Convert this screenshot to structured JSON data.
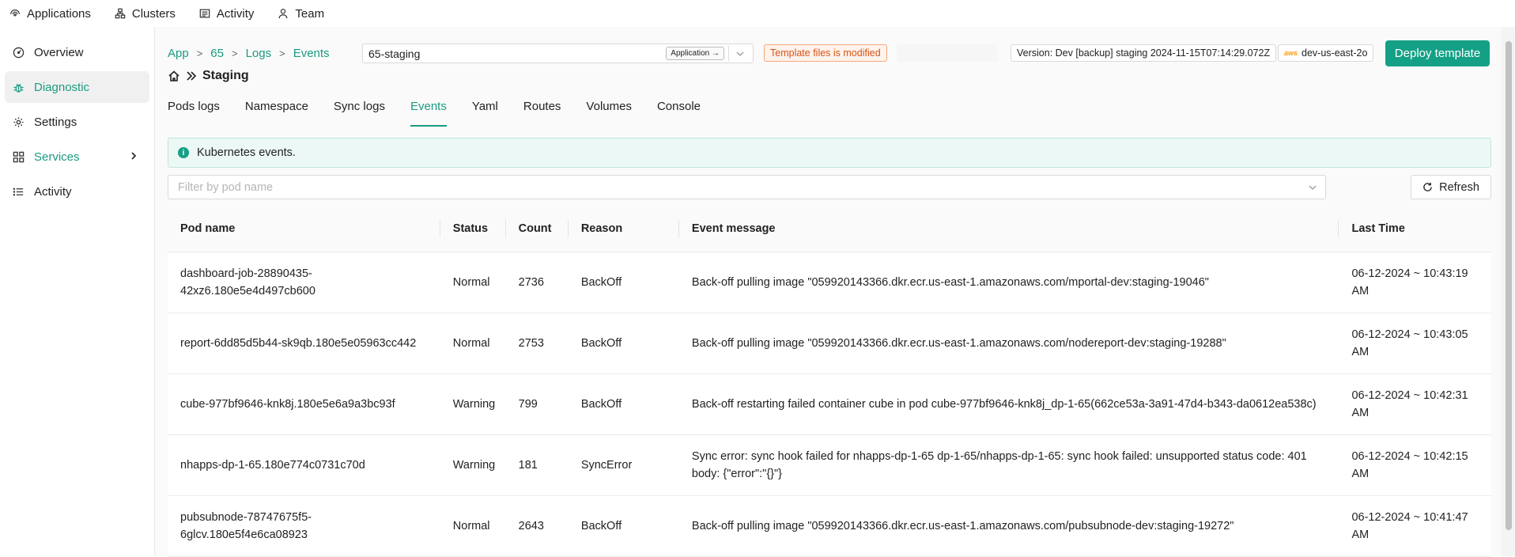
{
  "topnav": [
    {
      "label": "Applications",
      "icon": "applications-icon"
    },
    {
      "label": "Clusters",
      "icon": "clusters-icon"
    },
    {
      "label": "Activity",
      "icon": "activity-icon"
    },
    {
      "label": "Team",
      "icon": "team-icon"
    }
  ],
  "sidebar": {
    "items": [
      {
        "label": "Overview",
        "icon": "dashboard-icon"
      },
      {
        "label": "Diagnostic",
        "icon": "bug-icon"
      },
      {
        "label": "Settings",
        "icon": "gear-icon"
      },
      {
        "label": "Services",
        "icon": "services-icon"
      },
      {
        "label": "Activity",
        "icon": "list-icon"
      }
    ]
  },
  "breadcrumb": [
    "App",
    "65",
    "Logs",
    "Events"
  ],
  "environment": {
    "value": "65-staging",
    "app_button": "Application →"
  },
  "status_badge": "Template files is modified",
  "version": "Version: Dev [backup] staging 2024-11-15T07:14:29.072Z",
  "cluster": {
    "provider": "aws",
    "name": "dev-us-east-2o"
  },
  "deploy_button": "Deploy template",
  "page_title": "Staging",
  "tabs": [
    "Pods logs",
    "Namespace",
    "Sync logs",
    "Events",
    "Yaml",
    "Routes",
    "Volumes",
    "Console"
  ],
  "active_tab": "Events",
  "info_text": "Kubernetes events.",
  "filter": {
    "placeholder": "Filter by pod name"
  },
  "refresh_button": "Refresh",
  "table": {
    "columns": [
      "Pod name",
      "Status",
      "Count",
      "Reason",
      "Event message",
      "Last Time"
    ],
    "rows": [
      {
        "pod": "dashboard-job-28890435-42xz6.180e5e4d497cb600",
        "status": "Normal",
        "count": "2736",
        "reason": "BackOff",
        "message": "Back-off pulling image \"059920143366.dkr.ecr.us-east-1.amazonaws.com/mportal-dev:staging-19046\"",
        "time": "06-12-2024 ~ 10:43:19 AM"
      },
      {
        "pod": "report-6dd85d5b44-sk9qb.180e5e05963cc442",
        "status": "Normal",
        "count": "2753",
        "reason": "BackOff",
        "message": "Back-off pulling image \"059920143366.dkr.ecr.us-east-1.amazonaws.com/nodereport-dev:staging-19288\"",
        "time": "06-12-2024 ~ 10:43:05 AM"
      },
      {
        "pod": "cube-977bf9646-knk8j.180e5e6a9a3bc93f",
        "status": "Warning",
        "count": "799",
        "reason": "BackOff",
        "message": "Back-off restarting failed container cube in pod cube-977bf9646-knk8j_dp-1-65(662ce53a-3a91-47d4-b343-da0612ea538c)",
        "time": "06-12-2024 ~ 10:42:31 AM"
      },
      {
        "pod": "nhapps-dp-1-65.180e774c0731c70d",
        "status": "Warning",
        "count": "181",
        "reason": "SyncError",
        "message": "Sync error: sync hook failed for nhapps-dp-1-65 dp-1-65/nhapps-dp-1-65: sync hook failed: unsupported status code: 401 body: {\"error\":\"{}\"}",
        "time": "06-12-2024 ~ 10:42:15 AM"
      },
      {
        "pod": "pubsubnode-78747675f5-6glcv.180e5f4e6ca08923",
        "status": "Normal",
        "count": "2643",
        "reason": "BackOff",
        "message": "Back-off pulling image \"059920143366.dkr.ecr.us-east-1.amazonaws.com/pubsubnode-dev:staging-19272\"",
        "time": "06-12-2024 ~ 10:41:47 AM"
      }
    ]
  },
  "colors": {
    "accent": "#1a9b82",
    "primary_button": "#14a086",
    "warning_badge": "#d55417"
  }
}
